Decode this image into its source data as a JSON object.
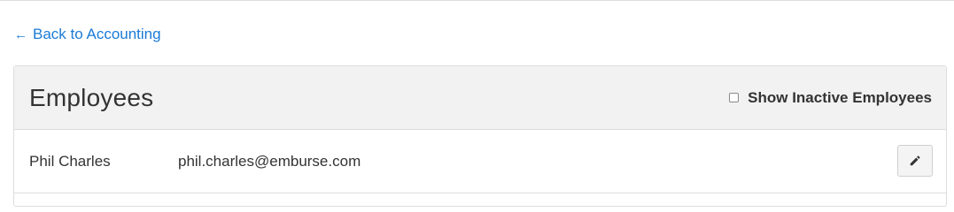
{
  "back_link": {
    "label": "Back to Accounting",
    "icon": "arrow-left-icon"
  },
  "panel": {
    "title": "Employees",
    "show_inactive": {
      "label": "Show Inactive Employees",
      "checked": false
    }
  },
  "employees": [
    {
      "name": "Phil Charles",
      "email": "phil.charles@emburse.com",
      "action_icon": "pencil-icon"
    }
  ],
  "colors": {
    "link": "#1a7bd6",
    "header_bg": "#f2f2f2",
    "border": "#dddddd"
  }
}
